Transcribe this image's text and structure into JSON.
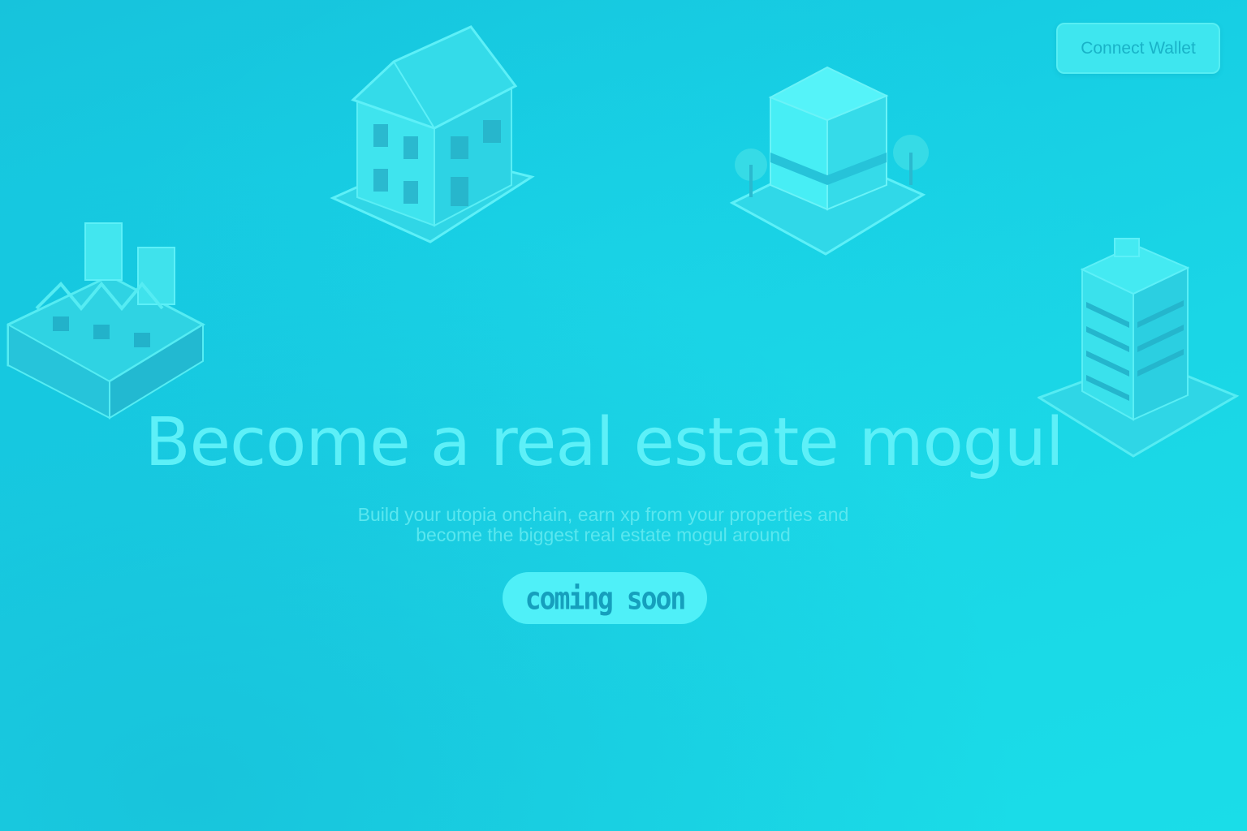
{
  "header": {
    "connect_wallet_label": "Connect Wallet"
  },
  "hero": {
    "headline": "Become a real estate mogul",
    "subtitle_line1": "Build your utopia onchain, earn xp from your properties and",
    "subtitle_line2": "become the biggest real estate mogul around",
    "cta_label": "coming soon"
  },
  "illustrations": [
    {
      "name": "house-illustration"
    },
    {
      "name": "shop-illustration"
    },
    {
      "name": "factory-illustration"
    },
    {
      "name": "apartment-tower-illustration"
    }
  ],
  "colors": {
    "background": "#18d2e6",
    "accent": "#5df0f8",
    "button_text": "#19b3c8",
    "building_fill": "#3fe6ef"
  }
}
